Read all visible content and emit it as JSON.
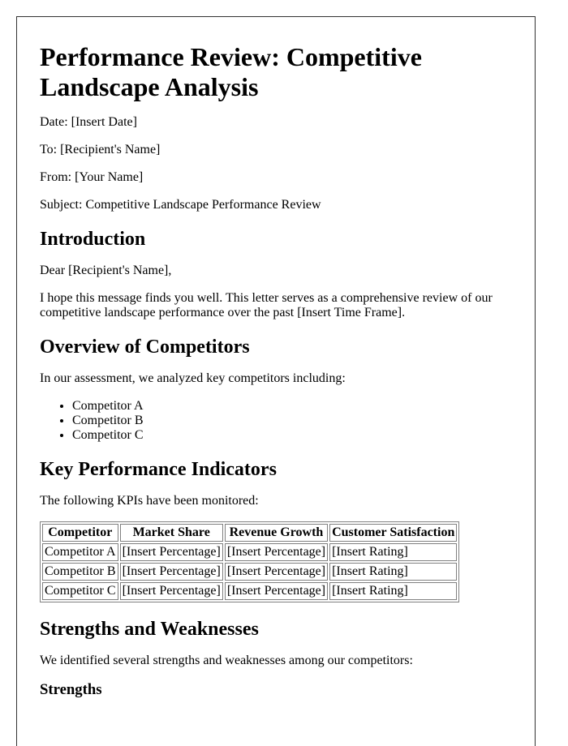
{
  "document": {
    "title": "Performance Review: Competitive Landscape Analysis",
    "meta": {
      "date": "Date: [Insert Date]",
      "to": "To: [Recipient's Name]",
      "from": "From: [Your Name]",
      "subject": "Subject: Competitive Landscape Performance Review"
    },
    "introduction": {
      "heading": "Introduction",
      "salutation": "Dear [Recipient's Name],",
      "body": "I hope this message finds you well. This letter serves as a comprehensive review of our competitive landscape performance over the past [Insert Time Frame]."
    },
    "overview": {
      "heading": "Overview of Competitors",
      "intro": "In our assessment, we analyzed key competitors including:",
      "competitors": [
        "Competitor A",
        "Competitor B",
        "Competitor C"
      ]
    },
    "kpis": {
      "heading": "Key Performance Indicators",
      "intro": "The following KPIs have been monitored:",
      "table": {
        "headers": [
          "Competitor",
          "Market Share",
          "Revenue Growth",
          "Customer Satisfaction"
        ],
        "rows": [
          [
            "Competitor A",
            "[Insert Percentage]",
            "[Insert Percentage]",
            "[Insert Rating]"
          ],
          [
            "Competitor B",
            "[Insert Percentage]",
            "[Insert Percentage]",
            "[Insert Rating]"
          ],
          [
            "Competitor C",
            "[Insert Percentage]",
            "[Insert Percentage]",
            "[Insert Rating]"
          ]
        ]
      }
    },
    "strengths_weaknesses": {
      "heading": "Strengths and Weaknesses",
      "intro": "We identified several strengths and weaknesses among our competitors:",
      "strengths_heading": "Strengths"
    }
  }
}
